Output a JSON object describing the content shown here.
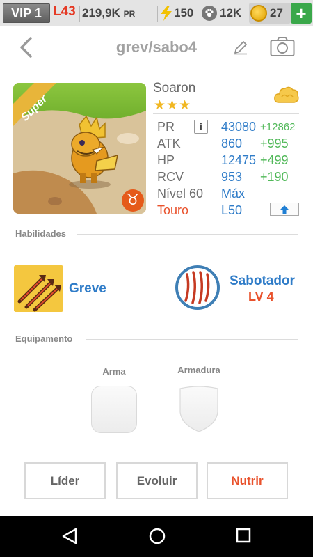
{
  "topbar": {
    "vip": "VIP 1",
    "level": "L43",
    "pr_value": "219,9K",
    "pr_unit": "PR",
    "energy": "150",
    "paws": "12K",
    "coins": "27",
    "plus": "+"
  },
  "header": {
    "title": "grev/sabo4"
  },
  "creature": {
    "badge": "Super",
    "name": "Soaron",
    "stars": "★★★",
    "zodiac_symbol": "♉",
    "stats": [
      {
        "label": "PR",
        "value": "43080",
        "bonus": "+12862"
      },
      {
        "label": "ATK",
        "value": "860",
        "bonus": "+995"
      },
      {
        "label": "HP",
        "value": "12475",
        "bonus": "+499"
      },
      {
        "label": "RCV",
        "value": "953",
        "bonus": "+190"
      }
    ],
    "level_label": "Nível 60",
    "level_value": "Máx",
    "sign_label": "Touro",
    "sign_level": "L50",
    "info_glyph": "i"
  },
  "skills": {
    "section_label": "Habilidades",
    "skill1": {
      "name": "Greve"
    },
    "skill2": {
      "name": "Sabotador",
      "level": "LV 4"
    }
  },
  "equipment": {
    "section_label": "Equipamento",
    "weapon_label": "Arma",
    "armor_label": "Armadura"
  },
  "buttons": {
    "lider": "Líder",
    "evoluir": "Evoluir",
    "nutrir": "Nutrir"
  },
  "colors": {
    "accent_blue": "#2f7cc8",
    "accent_orange": "#e9522c",
    "bonus_green": "#52b95a",
    "level_red": "#e53a25",
    "star_gold": "#f1b722"
  },
  "icons": [
    "back-chevron-icon",
    "edit-pencil-icon",
    "camera-icon",
    "info-icon",
    "cloud-icon",
    "upgrade-arrow-icon",
    "lightning-icon",
    "paw-icon",
    "coin-icon"
  ]
}
